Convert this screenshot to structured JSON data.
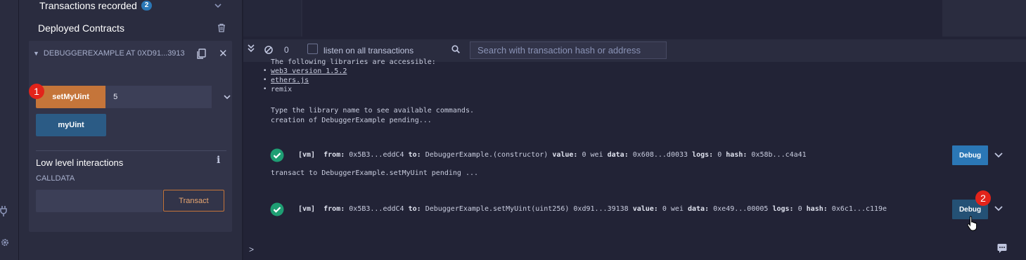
{
  "sidebar": {
    "transactions_recorded": {
      "label": "Transactions recorded",
      "count": "2"
    },
    "deployed_contracts": {
      "label": "Deployed Contracts"
    },
    "contract": {
      "title": "DEBUGGEREXAMPLE AT 0XD91...3913",
      "functions": [
        {
          "label": "setMyUint",
          "input_value": "5",
          "color": "#c5753a"
        },
        {
          "label": "myUint",
          "color": "#2b5b85"
        }
      ],
      "low_level": {
        "heading": "Low level interactions",
        "calldata_label": "CALLDATA",
        "calldata_value": "",
        "transact_label": "Transact"
      }
    }
  },
  "markers": {
    "first": "1",
    "second": "2"
  },
  "toolbar": {
    "count": "0",
    "listen_label": "listen on all transactions",
    "listen_checked": false,
    "search_placeholder": "Search with transaction hash or address"
  },
  "terminal": {
    "intro": "The following libraries are accessible:",
    "libraries": [
      "web3 version 1.5.2",
      "ethers.js",
      "remix"
    ],
    "help": "Type the library name to see available commands.",
    "pending1": "creation of DebuggerExample pending...",
    "tx1": {
      "vm": "[vm]",
      "from_label": "from:",
      "from": "0x5B3...eddC4",
      "to_label": "to:",
      "to": "DebuggerExample.(constructor)",
      "value_label": "value:",
      "value": "0 wei",
      "data_label": "data:",
      "data": "0x608...d0033",
      "logs_label": "logs:",
      "logs": "0",
      "hash_label": "hash:",
      "hash": "0x58b...c4a41",
      "debug_label": "Debug"
    },
    "pending2": "transact to DebuggerExample.setMyUint pending ...",
    "tx2": {
      "vm": "[vm]",
      "from_label": "from:",
      "from": "0x5B3...eddC4",
      "to_label": "to:",
      "to": "DebuggerExample.setMyUint(uint256) 0xd91...39138",
      "value_label": "value:",
      "value": "0 wei",
      "data_label": "data:",
      "data": "0xe49...00005",
      "logs_label": "logs:",
      "logs": "0",
      "hash_label": "hash:",
      "hash": "0x6c1...c119e",
      "debug_label": "Debug"
    },
    "prompt": ">"
  },
  "colors": {
    "accent_orange": "#c5753a",
    "accent_blue": "#2b77b6",
    "success_green": "#1e9e73",
    "marker_red": "#e2231a"
  },
  "icons": [
    "plug-icon",
    "gear-icon",
    "trash-icon",
    "copy-icon",
    "close-icon",
    "chevron-down-icon",
    "double-chevron-icon",
    "clear-icon",
    "search-icon",
    "check-circle-icon",
    "cursor-icon",
    "chat-icon",
    "info-icon"
  ]
}
